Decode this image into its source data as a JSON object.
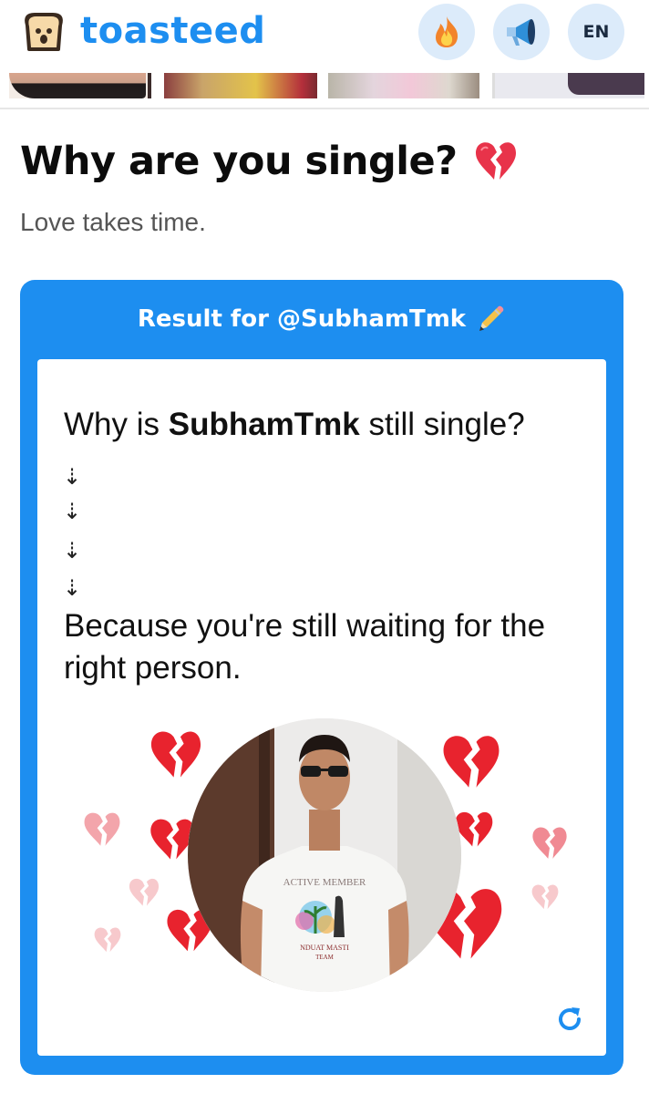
{
  "header": {
    "brand": "toasteed",
    "lang_label": "EN",
    "icons": [
      "toast-logo-icon",
      "fire-icon",
      "megaphone-icon"
    ],
    "accent": "#1d8ef0"
  },
  "page": {
    "title": "Why are you single?",
    "title_icon": "broken-heart-icon",
    "subtitle": "Love takes time."
  },
  "result": {
    "header_text": "Result for @SubhamTmk",
    "header_icon": "pencil-icon",
    "question_prefix": "Why is ",
    "question_name": "SubhamTmk",
    "question_suffix": " still single?",
    "arrows": [
      "⇣",
      "⇣",
      "⇣",
      "⇣"
    ],
    "answer": "Because you're still waiting for the right person.",
    "shirt_text_1": "ACTIVE MEMBER",
    "shirt_text_2": "NDUAT MASTI",
    "shirt_text_3": "TEAM",
    "refresh_icon": "refresh-icon"
  }
}
